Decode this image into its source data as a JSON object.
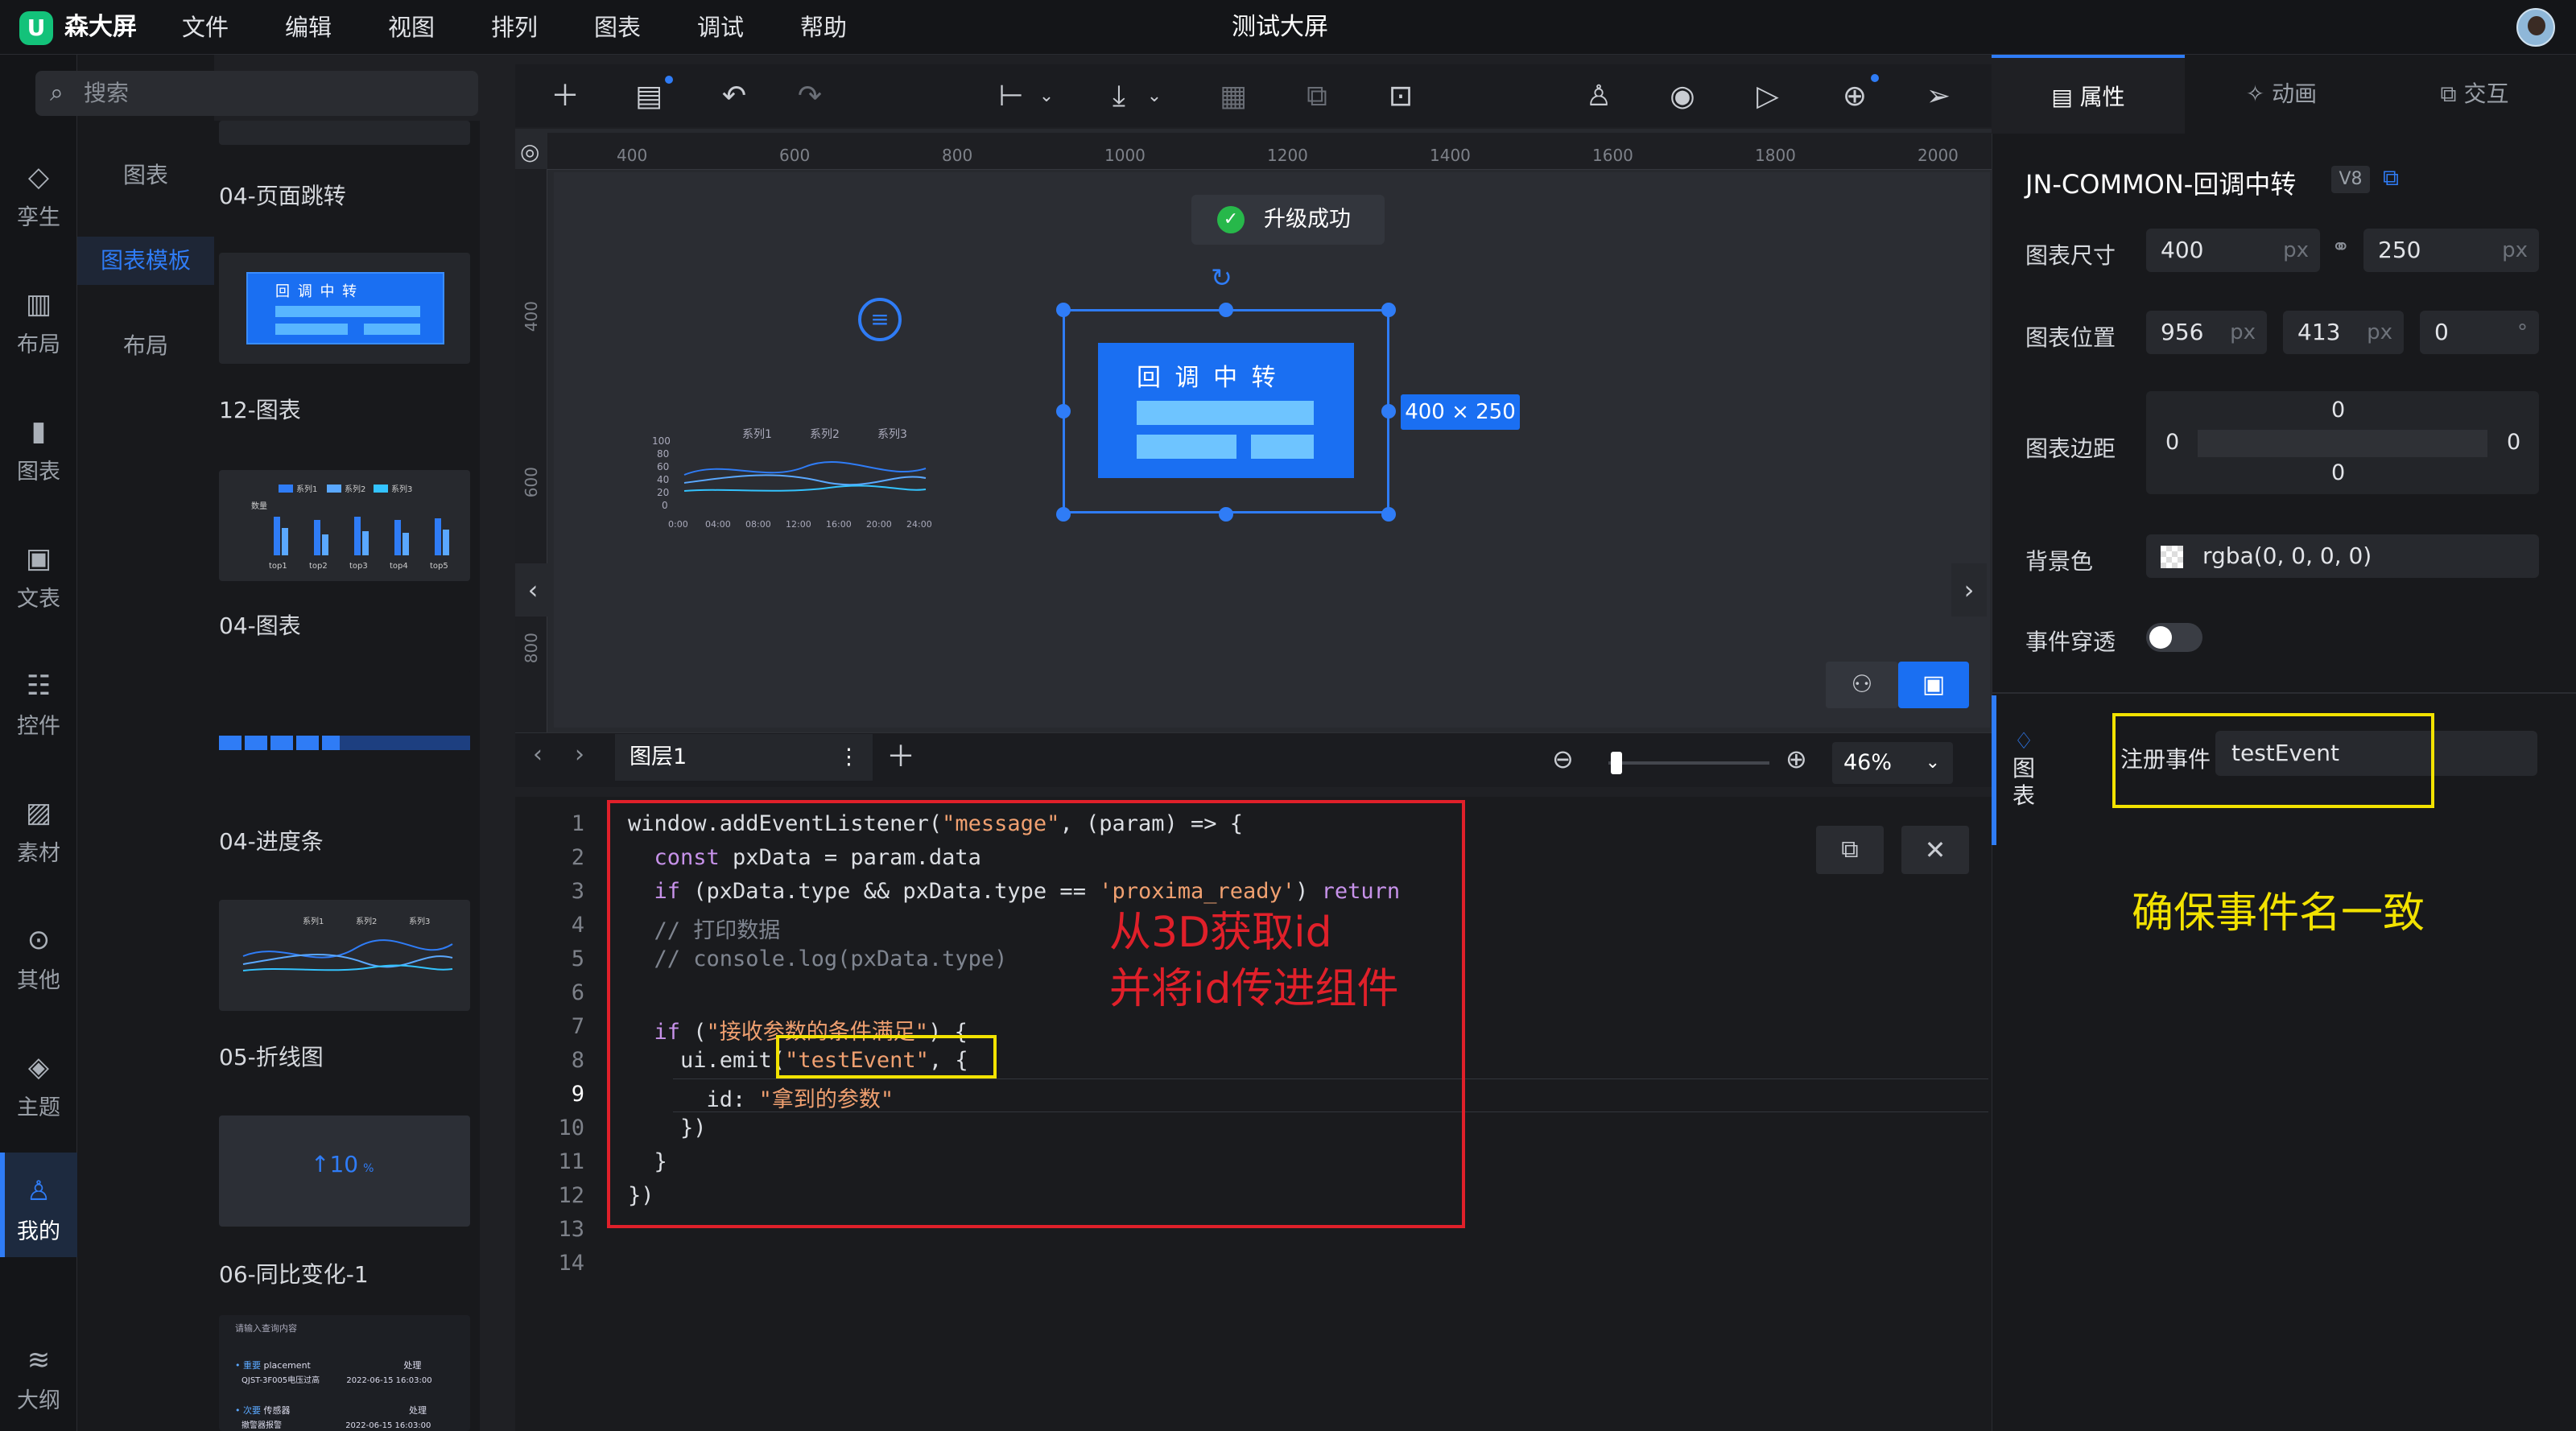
{
  "app": {
    "name": "森大屏",
    "title": "测试大屏",
    "logo_letter": "U"
  },
  "menu": [
    "文件",
    "编辑",
    "视图",
    "排列",
    "图表",
    "调试",
    "帮助"
  ],
  "left_nav": [
    {
      "label": "孪生",
      "icon": "twin-icon"
    },
    {
      "label": "布局",
      "icon": "layout-icon"
    },
    {
      "label": "图表",
      "icon": "chart-icon"
    },
    {
      "label": "文表",
      "icon": "text-icon"
    },
    {
      "label": "控件",
      "icon": "widget-icon"
    },
    {
      "label": "素材",
      "icon": "image-icon"
    },
    {
      "label": "其他",
      "icon": "more-icon"
    },
    {
      "label": "主题",
      "icon": "theme-icon"
    },
    {
      "label": "我的",
      "icon": "user-icon",
      "active": true
    },
    {
      "label": "大纲",
      "icon": "layers-icon"
    }
  ],
  "sub_nav": [
    {
      "label": "图表"
    },
    {
      "label": "图表模板",
      "active": true
    },
    {
      "label": "布局"
    }
  ],
  "search": {
    "placeholder": "搜索"
  },
  "templates": [
    {
      "label": "04-页面跳转"
    },
    {
      "label": "12-图表",
      "thumb_text": "回 调 中 转"
    },
    {
      "label": "04-图表",
      "legend": [
        "系列1",
        "系列2",
        "系列3"
      ],
      "cats": [
        "top1",
        "top2",
        "top3",
        "top4",
        "top5"
      ],
      "ylabel": "数量"
    },
    {
      "label": "04-进度条"
    },
    {
      "label": "05-折线图",
      "legend": [
        "系列1",
        "系列2",
        "系列3"
      ]
    },
    {
      "label": "06-同比变化-1",
      "thumb_text": "↑10",
      "thumb_unit": "%"
    },
    {
      "search": "请输入查询内容",
      "rows": [
        {
          "tag": "• 重要",
          "name": "placement",
          "status": "处理",
          "id": "QJST-3F005电压过高",
          "time": "2022-06-15 16:03:00"
        },
        {
          "tag": "• 次要",
          "name": "传感器",
          "status": "处理",
          "id": "撤警器报警",
          "time": "2022-06-15 16:03:00"
        }
      ]
    }
  ],
  "toolbar": {
    "icons": [
      "add-icon",
      "save-icon",
      "undo-icon",
      "redo-icon",
      "align-icon",
      "download-icon",
      "group-icon",
      "ungroup-icon",
      "unlock-icon",
      "user-icon",
      "camera-icon",
      "play-icon",
      "publish-icon",
      "send-icon"
    ]
  },
  "ruler": {
    "h": [
      "400",
      "600",
      "800",
      "1000",
      "1200",
      "1400",
      "1600",
      "1800",
      "2000"
    ],
    "v": [
      "400",
      "600",
      "800"
    ]
  },
  "canvas": {
    "toast": "升级成功",
    "component_title": "回 调 中 转",
    "size_badge": "400 × 250",
    "mini_chart": {
      "legend": [
        "系列1",
        "系列2",
        "系列3"
      ],
      "y": [
        "100",
        "80",
        "60",
        "40",
        "20",
        "0"
      ],
      "x": [
        "0:00",
        "04:00",
        "08:00",
        "12:00",
        "16:00",
        "20:00",
        "24:00"
      ]
    }
  },
  "layerbar": {
    "layer_name": "图层1",
    "zoom": "46%",
    "zoom_level": 0.05
  },
  "code": {
    "lines": [
      "1",
      "2",
      "3",
      "4",
      "5",
      "6",
      "7",
      "8",
      "9",
      "10",
      "11",
      "12",
      "13",
      "14"
    ],
    "annotation": "从3D获取id\n并将id传进组件"
  },
  "right": {
    "tabs": [
      "属性",
      "动画",
      "交互"
    ],
    "component_name": "JN-COMMON-回调中转",
    "version": "V8",
    "size_label": "图表尺寸",
    "width": "400",
    "height": "250",
    "unit_px": "px",
    "pos_label": "图表位置",
    "pos_x": "956",
    "pos_y": "413",
    "rotate": "0",
    "unit_deg": "°",
    "margin_label": "图表边距",
    "margin_top": "0",
    "margin_left": "0",
    "margin_right": "0",
    "margin_bottom": "0",
    "bg_label": "背景色",
    "bg_value": "rgba(0, 0, 0, 0)",
    "event_label": "事件穿透",
    "event_on": false,
    "section_tab": "图表",
    "register_label": "注册事件",
    "register_value": "testEvent",
    "note": "确保事件名一致"
  },
  "colors": {
    "accent": "#2f7cf6",
    "red": "#e0202a",
    "yellow": "#f2e200"
  }
}
